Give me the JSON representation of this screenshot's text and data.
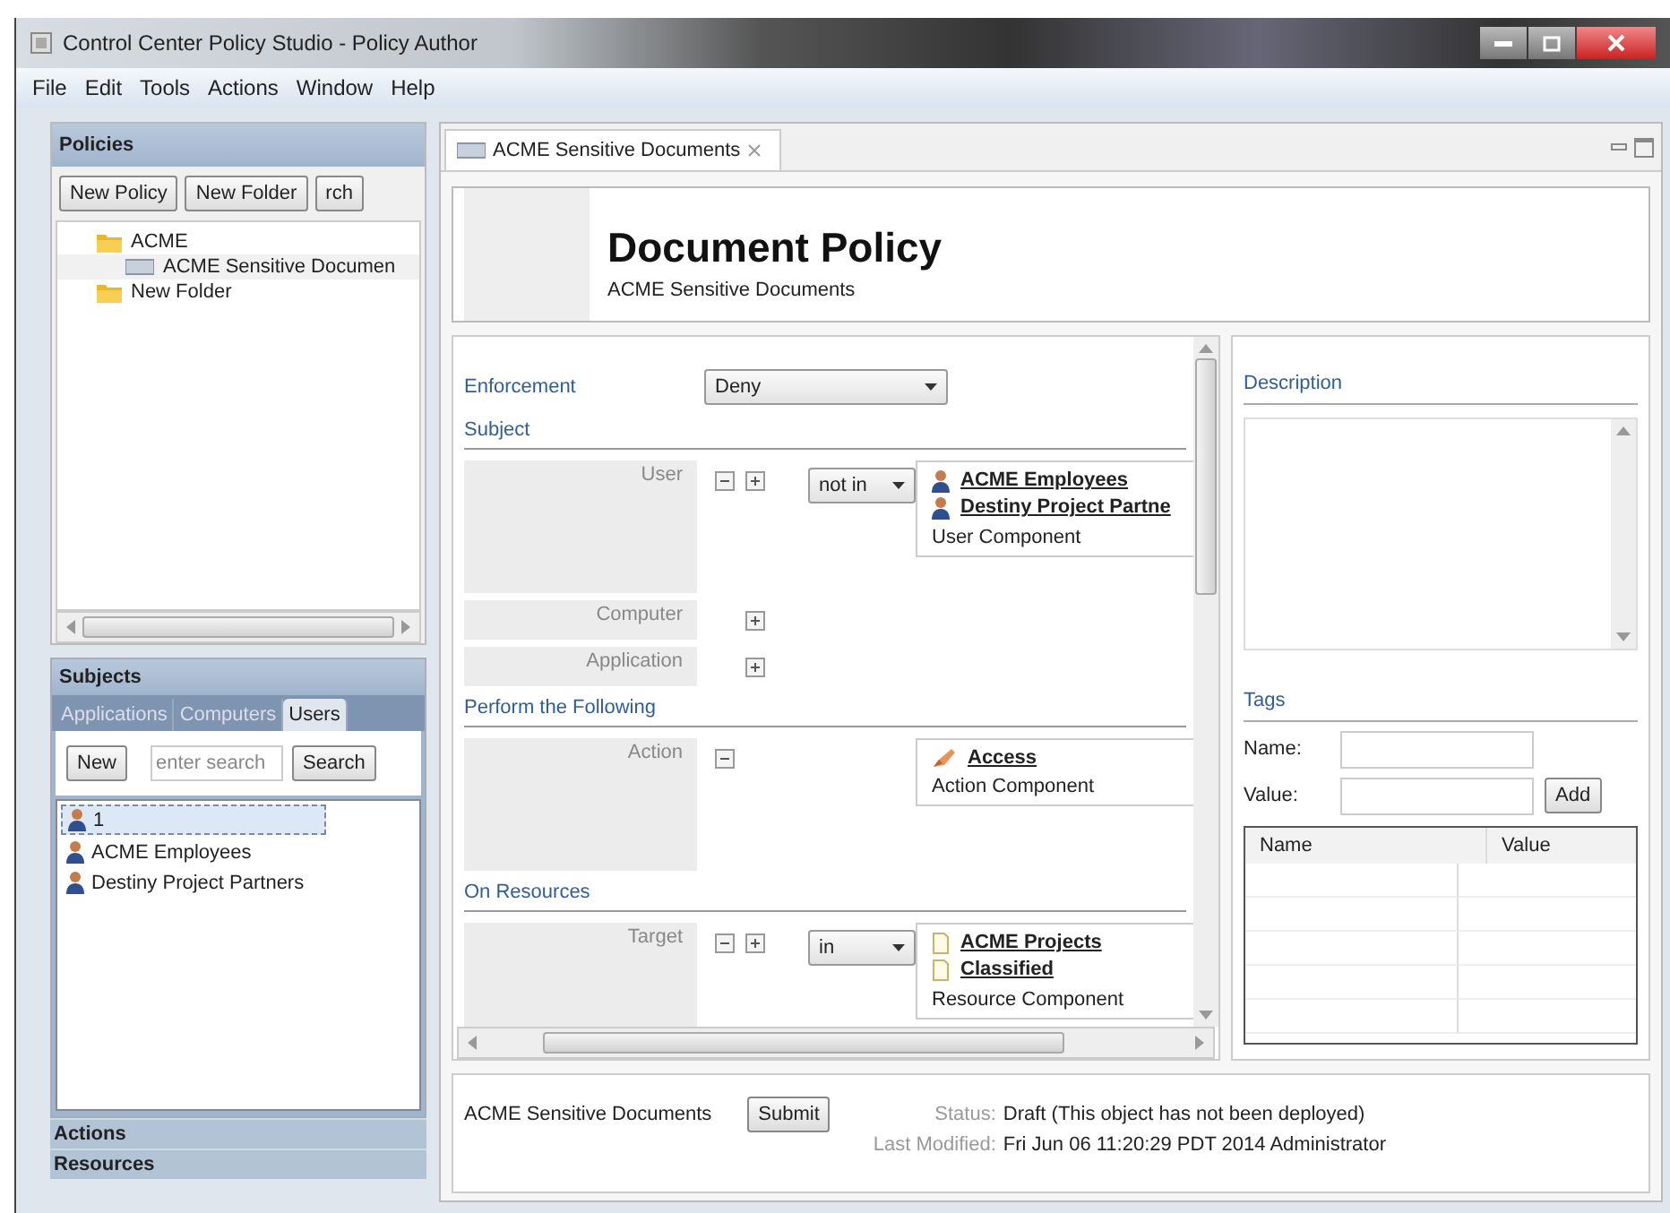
{
  "window": {
    "title": "Control Center Policy Studio - Policy Author"
  },
  "menu": [
    "File",
    "Edit",
    "Tools",
    "Actions",
    "Window",
    "Help"
  ],
  "policies_panel": {
    "title": "Policies",
    "buttons": [
      "New Policy",
      "New Folder",
      "rch"
    ],
    "tree": [
      {
        "label": "ACME",
        "kind": "folder",
        "selected": false,
        "children": [
          {
            "label": "ACME Sensitive Documen",
            "kind": "policy",
            "selected": true
          }
        ]
      },
      {
        "label": "New Folder",
        "kind": "folder",
        "selected": false
      }
    ]
  },
  "subjects_panel": {
    "title": "Subjects",
    "tabs": [
      {
        "label": "Applications",
        "selected": false
      },
      {
        "label": "Computers",
        "selected": false
      },
      {
        "label": "Users",
        "selected": true
      }
    ],
    "new_button": "New",
    "search": {
      "placeholder": "enter search"
    },
    "search_button": "Search",
    "items": [
      {
        "label": "1",
        "selected": true
      },
      {
        "label": "ACME Employees",
        "selected": false
      },
      {
        "label": "Destiny Project Partners",
        "selected": false
      }
    ]
  },
  "collapsed_sections": [
    "Actions",
    "Resources"
  ],
  "editor_tab": {
    "label": "ACME Sensitive Documents"
  },
  "header": {
    "title": "Document Policy",
    "subtitle": "ACME Sensitive Documents"
  },
  "form": {
    "enforcement": {
      "label": "Enforcement",
      "value": "Deny"
    },
    "sections": [
      {
        "title": "Subject",
        "rows": [
          {
            "label": "User",
            "can_remove": true,
            "can_add": true,
            "operator": "not in",
            "component": {
              "items": [
                {
                  "label": "ACME Employees",
                  "kind": "user"
                },
                {
                  "label": "Destiny Project Partne",
                  "kind": "user"
                }
              ],
              "caption": "User Component"
            }
          },
          {
            "label": "Computer",
            "can_remove": false,
            "can_add": true
          },
          {
            "label": "Application",
            "can_remove": false,
            "can_add": true
          }
        ]
      },
      {
        "title": "Perform the Following",
        "rows": [
          {
            "label": "Action",
            "can_remove": true,
            "can_add": false,
            "component": {
              "items": [
                {
                  "label": "Access",
                  "kind": "action"
                }
              ],
              "caption": "Action Component"
            }
          }
        ]
      },
      {
        "title": "On Resources",
        "rows": [
          {
            "label": "Target",
            "can_remove": true,
            "can_add": true,
            "operator": "in",
            "component": {
              "items": [
                {
                  "label": "ACME Projects",
                  "kind": "document"
                },
                {
                  "label": "Classified",
                  "kind": "document"
                }
              ],
              "caption": "Resource Component"
            }
          }
        ]
      }
    ]
  },
  "description": {
    "title": "Description"
  },
  "tags": {
    "title": "Tags",
    "name_label": "Name:",
    "value_label": "Value:",
    "add_button": "Add",
    "columns": [
      "Name",
      "Value"
    ]
  },
  "footer": {
    "name": "ACME Sensitive Documents",
    "submit_button": "Submit",
    "status_label": "Status:",
    "status": "Draft (This object has not been deployed)",
    "modified_label": "Last Modified:",
    "modified": "Fri Jun 06 11:20:29 PDT 2014 Administrator"
  }
}
